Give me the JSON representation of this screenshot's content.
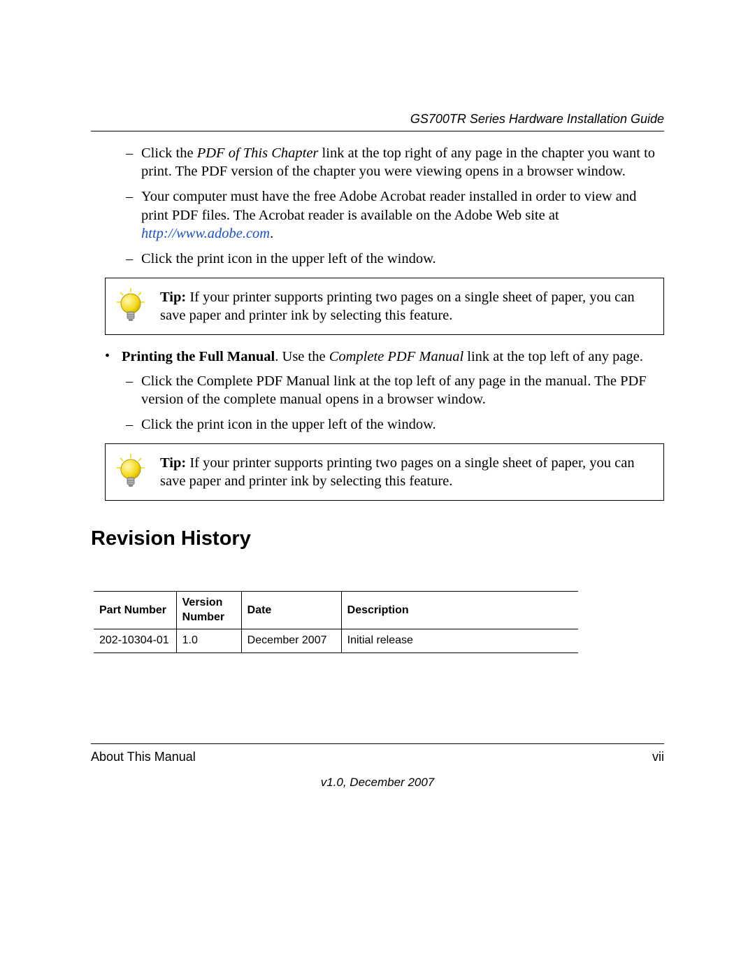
{
  "header": {
    "title": "GS700TR Series Hardware Installation Guide"
  },
  "content": {
    "nested1": {
      "item1_a": "Click the ",
      "item1_b": "PDF of This Chapter",
      "item1_c": " link at the top right of any page in the chapter you want to print. The PDF version of the chapter you were viewing opens in a browser window.",
      "item2_a": "Your computer must have the free Adobe Acrobat reader installed in order to view and print PDF files. The Acrobat reader is available on the Adobe Web site at ",
      "item2_link": "http://www.adobe.com",
      "item2_c": ".",
      "item3": "Click the print icon in the upper left of the window."
    },
    "tip1": {
      "label": "Tip:",
      "text": " If your printer supports printing two pages on a single sheet of paper, you can save paper and printer ink by selecting this feature."
    },
    "bullet2": {
      "bold": "Printing the Full Manual",
      "a": ". Use the ",
      "ital": "Complete PDF Manual",
      "b": " link at the top left of any page."
    },
    "nested2": {
      "item1": "Click the Complete PDF Manual link at the top left of any page in the manual. The PDF version of the complete manual opens in a browser window.",
      "item2": "Click the print icon in the upper left of the window."
    },
    "tip2": {
      "label": "Tip:",
      "text": " If your printer supports printing two pages on a single sheet of paper, you can save paper and printer ink by selecting this feature."
    },
    "section_heading": "Revision History",
    "table": {
      "headers": [
        "Part Number",
        "Version Number",
        "Date",
        "Description"
      ],
      "row": [
        "202-10304-01",
        "1.0",
        "December 2007",
        "Initial release"
      ]
    }
  },
  "footer": {
    "left": "About This Manual",
    "right": "vii",
    "center": "v1.0, December 2007"
  }
}
